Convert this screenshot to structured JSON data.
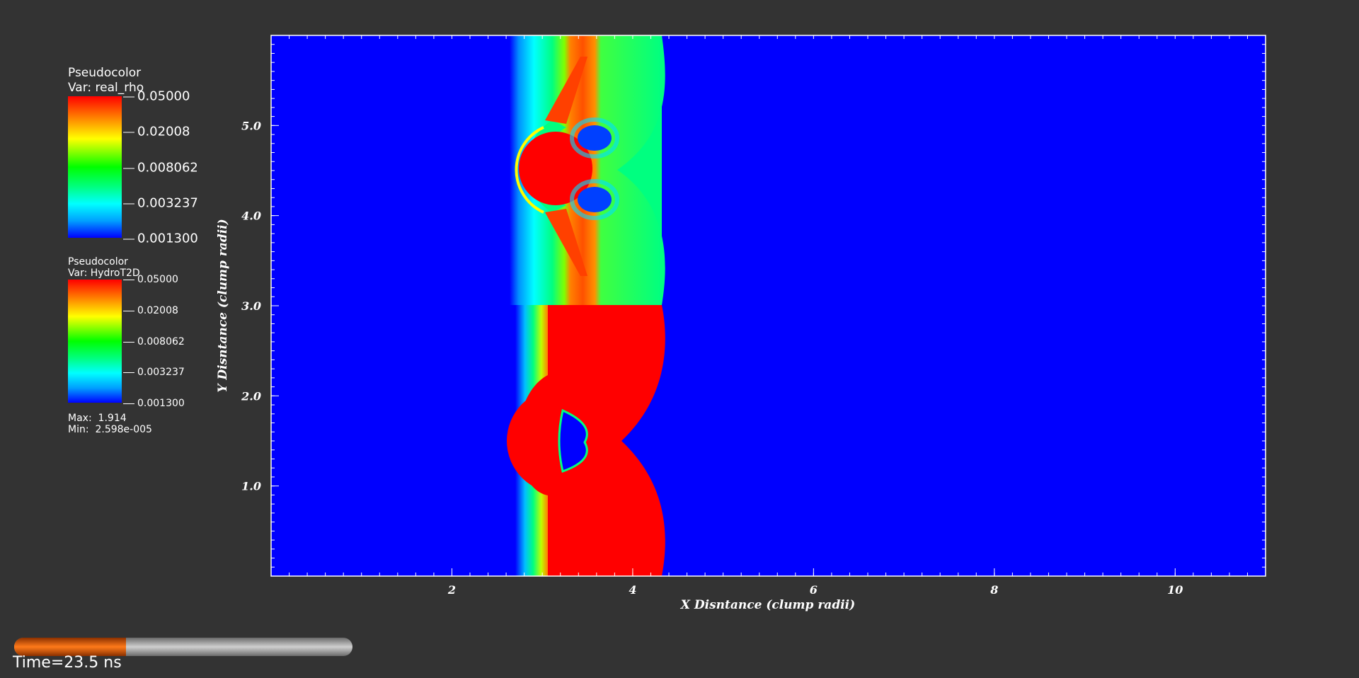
{
  "legend_rho": {
    "title_line1": "Pseudocolor",
    "title_line2": "Var: real_rho",
    "ticks": [
      "0.05000",
      "0.02008",
      "0.008062",
      "0.003237",
      "0.001300"
    ]
  },
  "legend_hydro": {
    "title_line1": "Pseudocolor",
    "title_line2": "Var: HydroT2D",
    "ticks": [
      "0.05000",
      "0.02008",
      "0.008062",
      "0.003237",
      "0.001300"
    ],
    "max_label": "Max:  1.914",
    "min_label": "Min:  2.598e-005"
  },
  "plot": {
    "xlabel": "X Disntance (clump radii)",
    "ylabel": "Y Disntance (clump radii)",
    "x_ticks": [
      2,
      4,
      6,
      8,
      10
    ],
    "x_tick_labels": [
      "2",
      "4",
      "6",
      "8",
      "10"
    ],
    "y_ticks": [
      1.0,
      2.0,
      3.0,
      4.0,
      5.0
    ],
    "y_tick_labels": [
      "1.0",
      "2.0",
      "3.0",
      "4.0",
      "5.0"
    ],
    "xlim": [
      0,
      11
    ],
    "ylim": [
      0,
      6
    ],
    "colors": {
      "background_field": "#0000ff",
      "high": "#ff0000",
      "mid": "#00ff80",
      "cyan": "#00ffff"
    }
  },
  "time_slider": {
    "progress": 0.33,
    "time_label": "Time=23.5 ns"
  }
}
